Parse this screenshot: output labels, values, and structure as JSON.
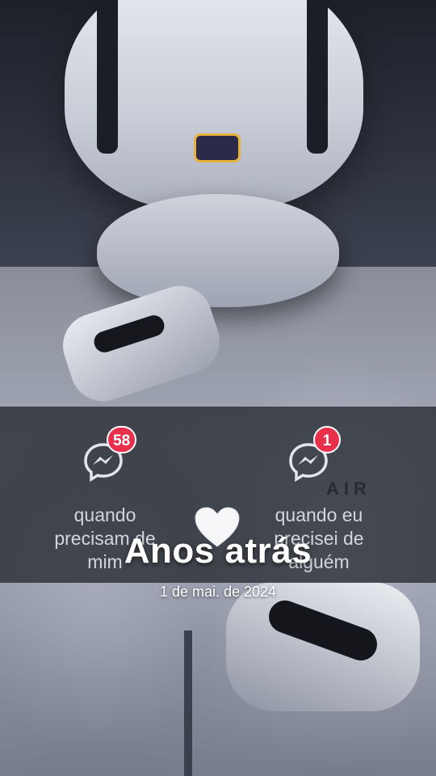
{
  "overlay": {
    "title": "Anos atrás",
    "date": "1 de mai. de 2024",
    "heart_icon": "white-heart-icon"
  },
  "left_card": {
    "badge_count": "58",
    "icon": "messenger-icon",
    "caption_lines": [
      "quando",
      "precisam de",
      "mim"
    ]
  },
  "right_card": {
    "badge_count": "1",
    "icon": "messenger-icon",
    "caption_lines": [
      "quando eu",
      "precisei de",
      "alguém"
    ]
  },
  "photo_text": {
    "jacket_logo": "AIR"
  },
  "colors": {
    "badge_red": "#e8304d",
    "band_overlay": "#1c1e24",
    "text_white": "#ffffff"
  }
}
